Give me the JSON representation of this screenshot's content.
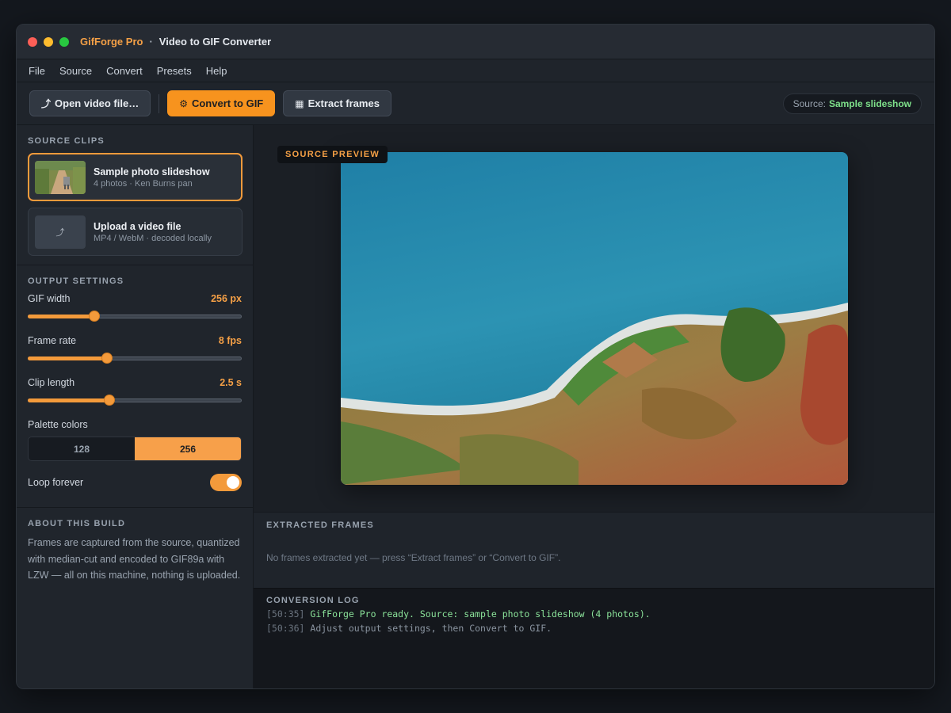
{
  "window": {
    "app_name": "GifForge Pro",
    "separator": "·",
    "title": "Video to GIF Converter"
  },
  "menu": [
    "File",
    "Source",
    "Convert",
    "Presets",
    "Help"
  ],
  "toolbar": {
    "open_icon": "upload-icon",
    "open_glyph": "⤴",
    "open_label": "Open video file…",
    "convert_icon": "gear-icon",
    "convert_glyph": "⚙",
    "convert_label": "Convert to GIF",
    "extract_icon": "grid-icon",
    "extract_glyph": "▦",
    "extract_label": "Extract frames",
    "source_prefix": "Source:",
    "source_value": "Sample slideshow"
  },
  "sidebar": {
    "clips_title": "SOURCE CLIPS",
    "clips": [
      {
        "title": "Sample photo slideshow",
        "subtitle": "4 photos · Ken Burns pan",
        "active": true
      },
      {
        "title": "Upload a video file",
        "subtitle": "MP4 / WebM · decoded locally",
        "icon_glyph": "⤴",
        "active": false
      }
    ],
    "output_title": "OUTPUT SETTINGS",
    "gif_width": {
      "label": "GIF width",
      "value": "256 px",
      "level": 0.31
    },
    "frame_rate": {
      "label": "Frame rate",
      "value": "8 fps",
      "level": 0.37
    },
    "clip_length": {
      "label": "Clip length",
      "value": "2.5 s",
      "level": 0.38
    },
    "palette": {
      "label": "Palette colors",
      "options": [
        "128",
        "256"
      ],
      "selected": "256"
    },
    "loop": {
      "label": "Loop forever",
      "on": true
    },
    "about_title": "ABOUT THIS BUILD",
    "about_text": "Frames are captured from the source, quantized with median-cut and encoded to GIF89a with LZW — all on this machine, nothing is uploaded."
  },
  "preview": {
    "label": "SOURCE PREVIEW"
  },
  "frames": {
    "title": "EXTRACTED FRAMES",
    "empty_text": "No frames extracted yet — press “Extract frames” or “Convert to GIF”."
  },
  "log": {
    "title": "CONVERSION LOG",
    "lines": [
      {
        "time": "[50:35]",
        "message": "GifForge Pro ready. Source: sample photo slideshow (4 photos).",
        "ok": true
      },
      {
        "time": "[50:36]",
        "message": "Adjust output settings, then Convert to GIF.",
        "ok": false
      }
    ]
  },
  "colors": {
    "accent": "#f7931e",
    "success": "#7ee08a",
    "background": "#1f242b"
  }
}
